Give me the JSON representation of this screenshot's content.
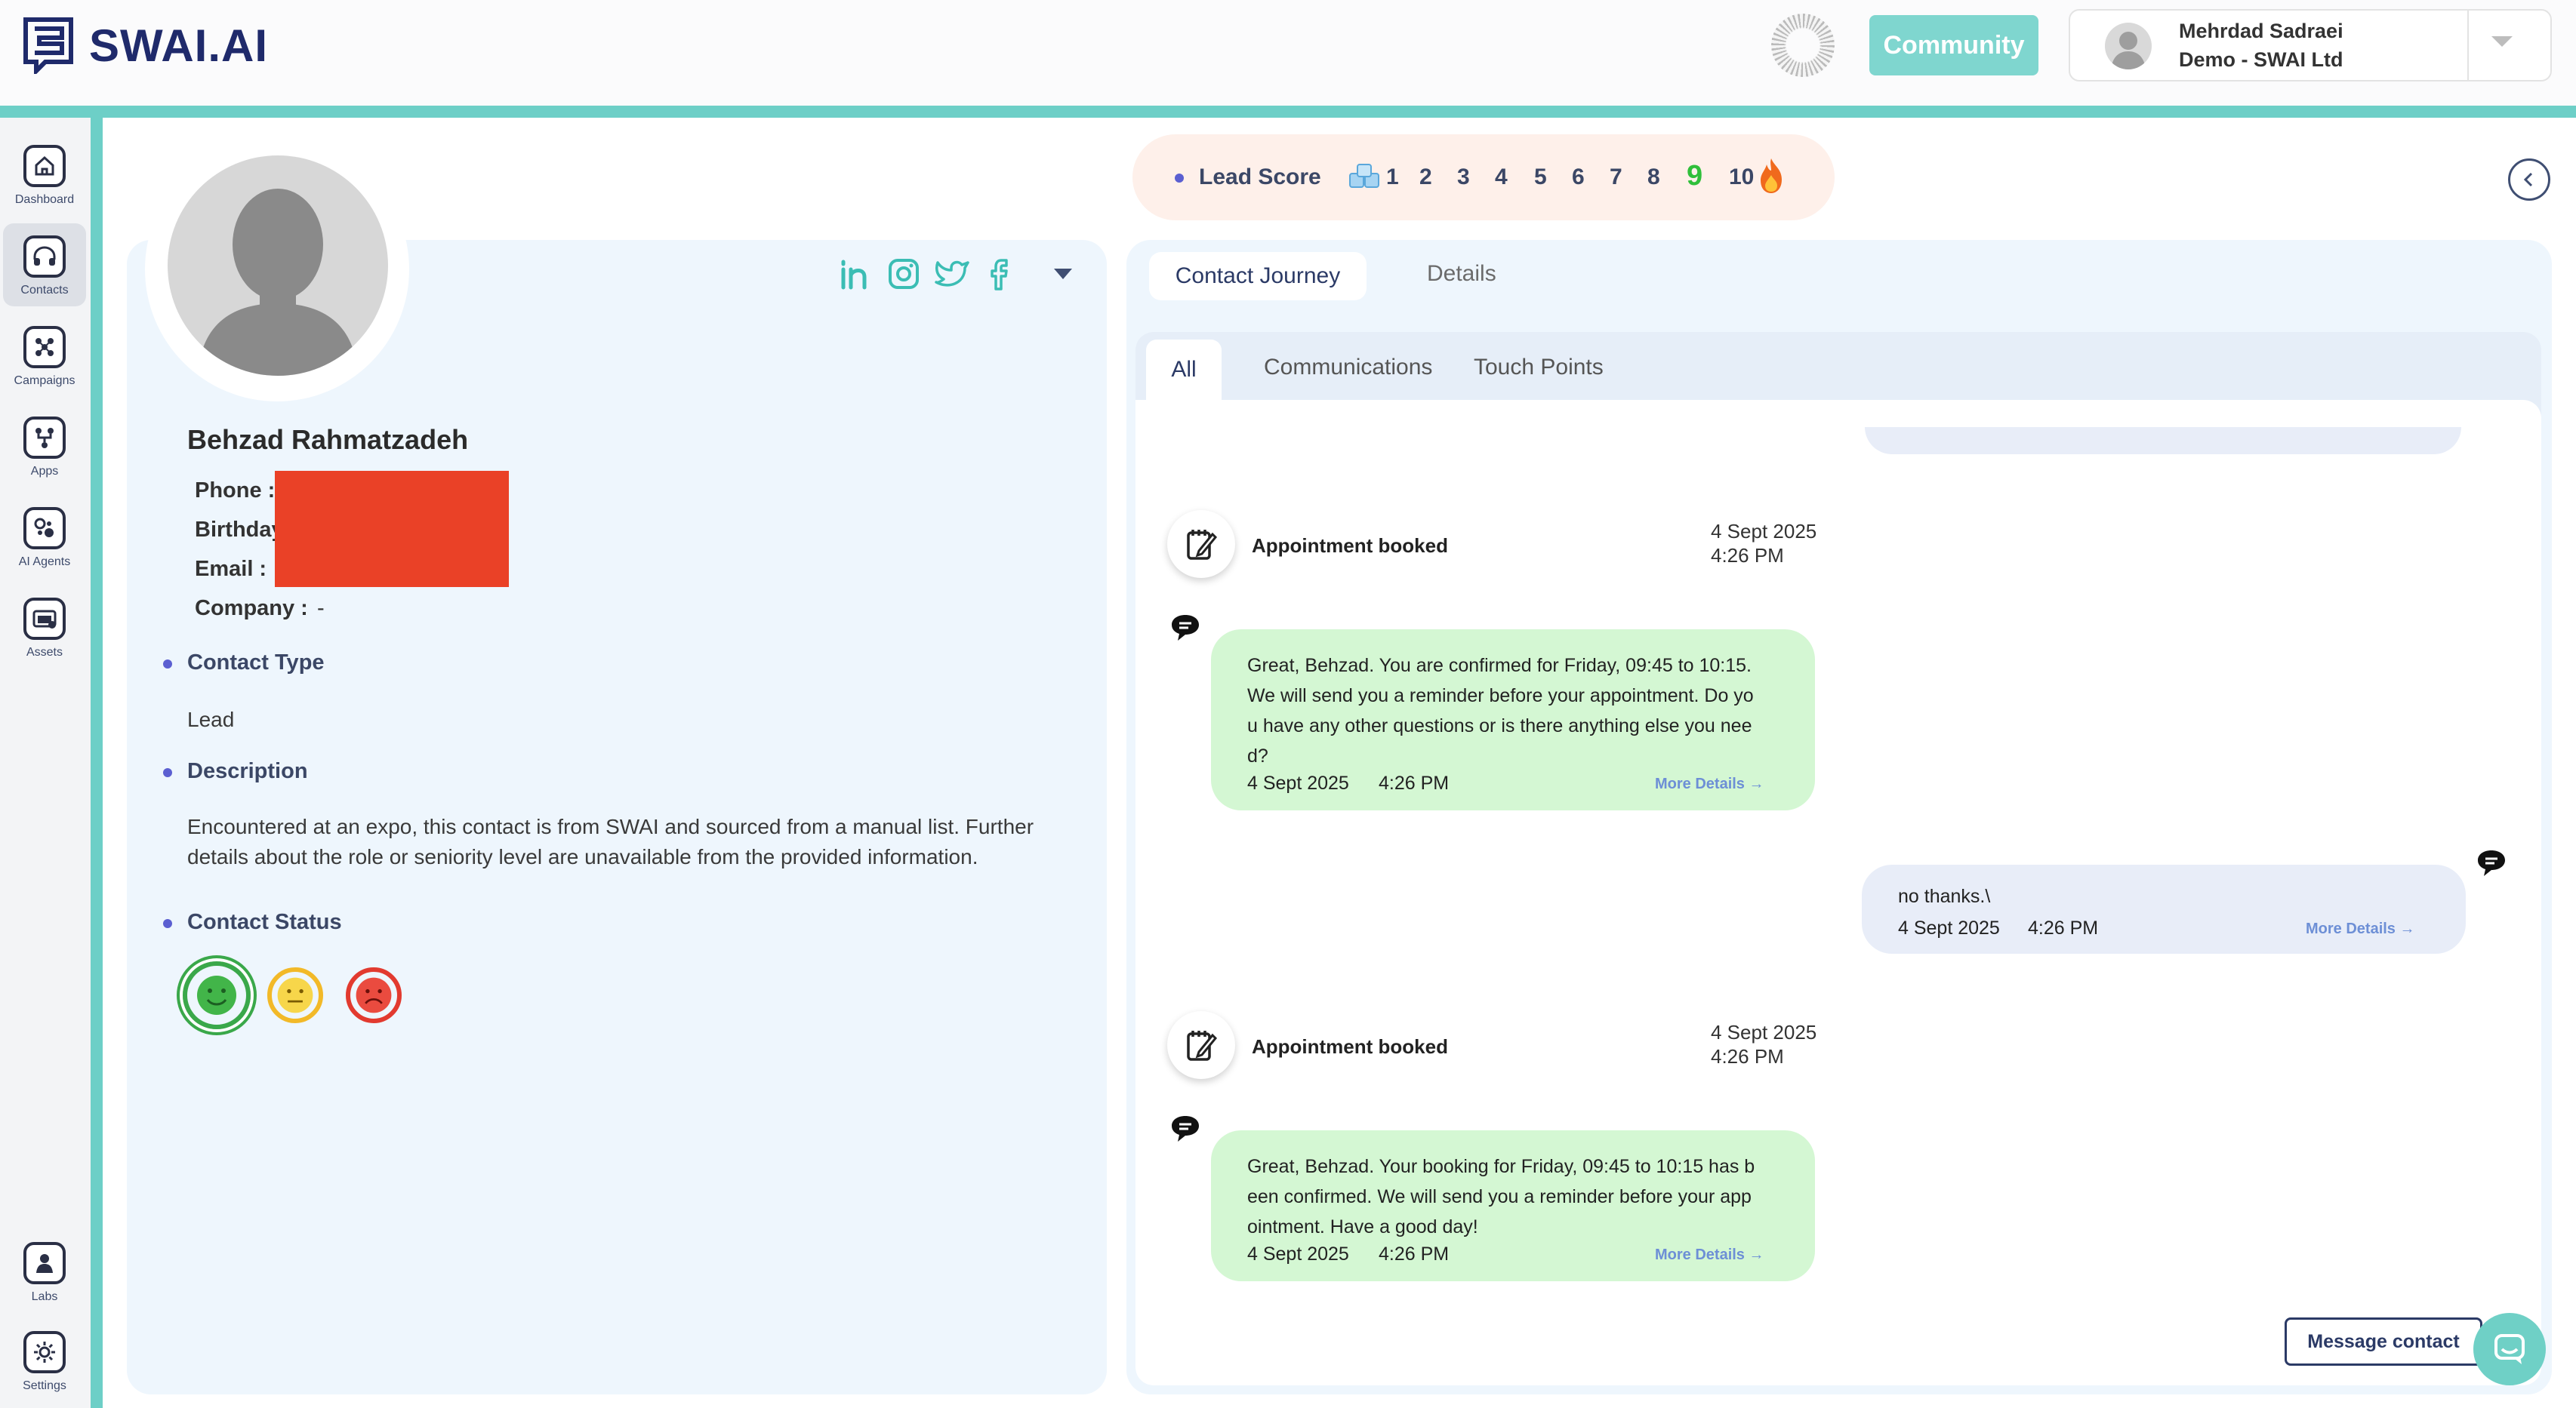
{
  "app": {
    "logo_text": "SWAI.AI",
    "community_label": "Community",
    "user_name": "Mehrdad Sadraei",
    "user_org": "Demo - SWAI Ltd"
  },
  "sidebar": {
    "items": [
      {
        "label": "Dashboard",
        "icon": "home-icon"
      },
      {
        "label": "Contacts",
        "icon": "headset-icon",
        "active": true
      },
      {
        "label": "Campaigns",
        "icon": "network-icon"
      },
      {
        "label": "Apps",
        "icon": "apps-flow-icon"
      },
      {
        "label": "AI Agents",
        "icon": "ai-agents-icon"
      },
      {
        "label": "Assets",
        "icon": "assets-icon"
      },
      {
        "label": "Labs",
        "icon": "labs-icon"
      },
      {
        "label": "Settings",
        "icon": "gear-icon"
      }
    ]
  },
  "contact": {
    "name": "Behzad Rahmatzadeh",
    "phone_label": "Phone :",
    "birthday_label": "Birthday :",
    "email_label": "Email :",
    "company_label": "Company :",
    "company_value": "-",
    "contact_type_title": "Contact Type",
    "contact_type_value": "Lead",
    "description_title": "Description",
    "description_line1": "Encountered at an expo, this contact is from SWAI and sourced from a manual list. Further",
    "description_line2": "details about the role or seniority level are unavailable from the provided information.",
    "status_title": "Contact Status",
    "status_selected": "happy",
    "social": [
      "linkedin-icon",
      "instagram-icon",
      "twitter-icon",
      "facebook-icon"
    ]
  },
  "lead_score": {
    "label": "Lead Score",
    "scores": [
      "1",
      "2",
      "3",
      "4",
      "5",
      "6",
      "7",
      "8",
      "9",
      "10"
    ],
    "selected": "9"
  },
  "journey": {
    "tabs": [
      "Contact Journey",
      "Details"
    ],
    "subtabs": [
      "All",
      "Communications",
      "Touch Points"
    ],
    "events": [
      {
        "type": "appointment",
        "label": "Appointment booked",
        "date": "4 Sept 2025",
        "time": "4:26 PM"
      },
      {
        "type": "message_out",
        "lines": [
          "Great, Behzad. You are confirmed for Friday, 09:45 to 10:15.",
          "We will send you a reminder before your appointment. Do yo",
          "u have any other questions or is there anything else you nee",
          "d?"
        ],
        "date": "4 Sept 2025",
        "time": "4:26 PM",
        "more": "More Details →"
      },
      {
        "type": "message_in",
        "lines": [
          "no thanks.\\"
        ],
        "date": "4 Sept 2025",
        "time": "4:26 PM",
        "more": "More Details →"
      },
      {
        "type": "appointment",
        "label": "Appointment booked",
        "date": "4 Sept 2025",
        "time": "4:26 PM"
      },
      {
        "type": "message_out",
        "lines": [
          "Great, Behzad. Your booking for Friday, 09:45 to 10:15 has b",
          "een confirmed. We will send you a reminder before your app",
          "ointment. Have a good day!"
        ],
        "date": "4 Sept 2025",
        "time": "4:26 PM",
        "more": "More Details →"
      }
    ]
  },
  "actions": {
    "message_contact": "Message contact"
  },
  "colors": {
    "teal": "#6dcfc7",
    "navy": "#1f2a6b",
    "panel_bg": "#eef6fd",
    "bubble_out": "#d4f7d3",
    "bubble_in": "#e8edf8",
    "score_selected": "#2fbf3a",
    "redaction": "#ea4127"
  }
}
